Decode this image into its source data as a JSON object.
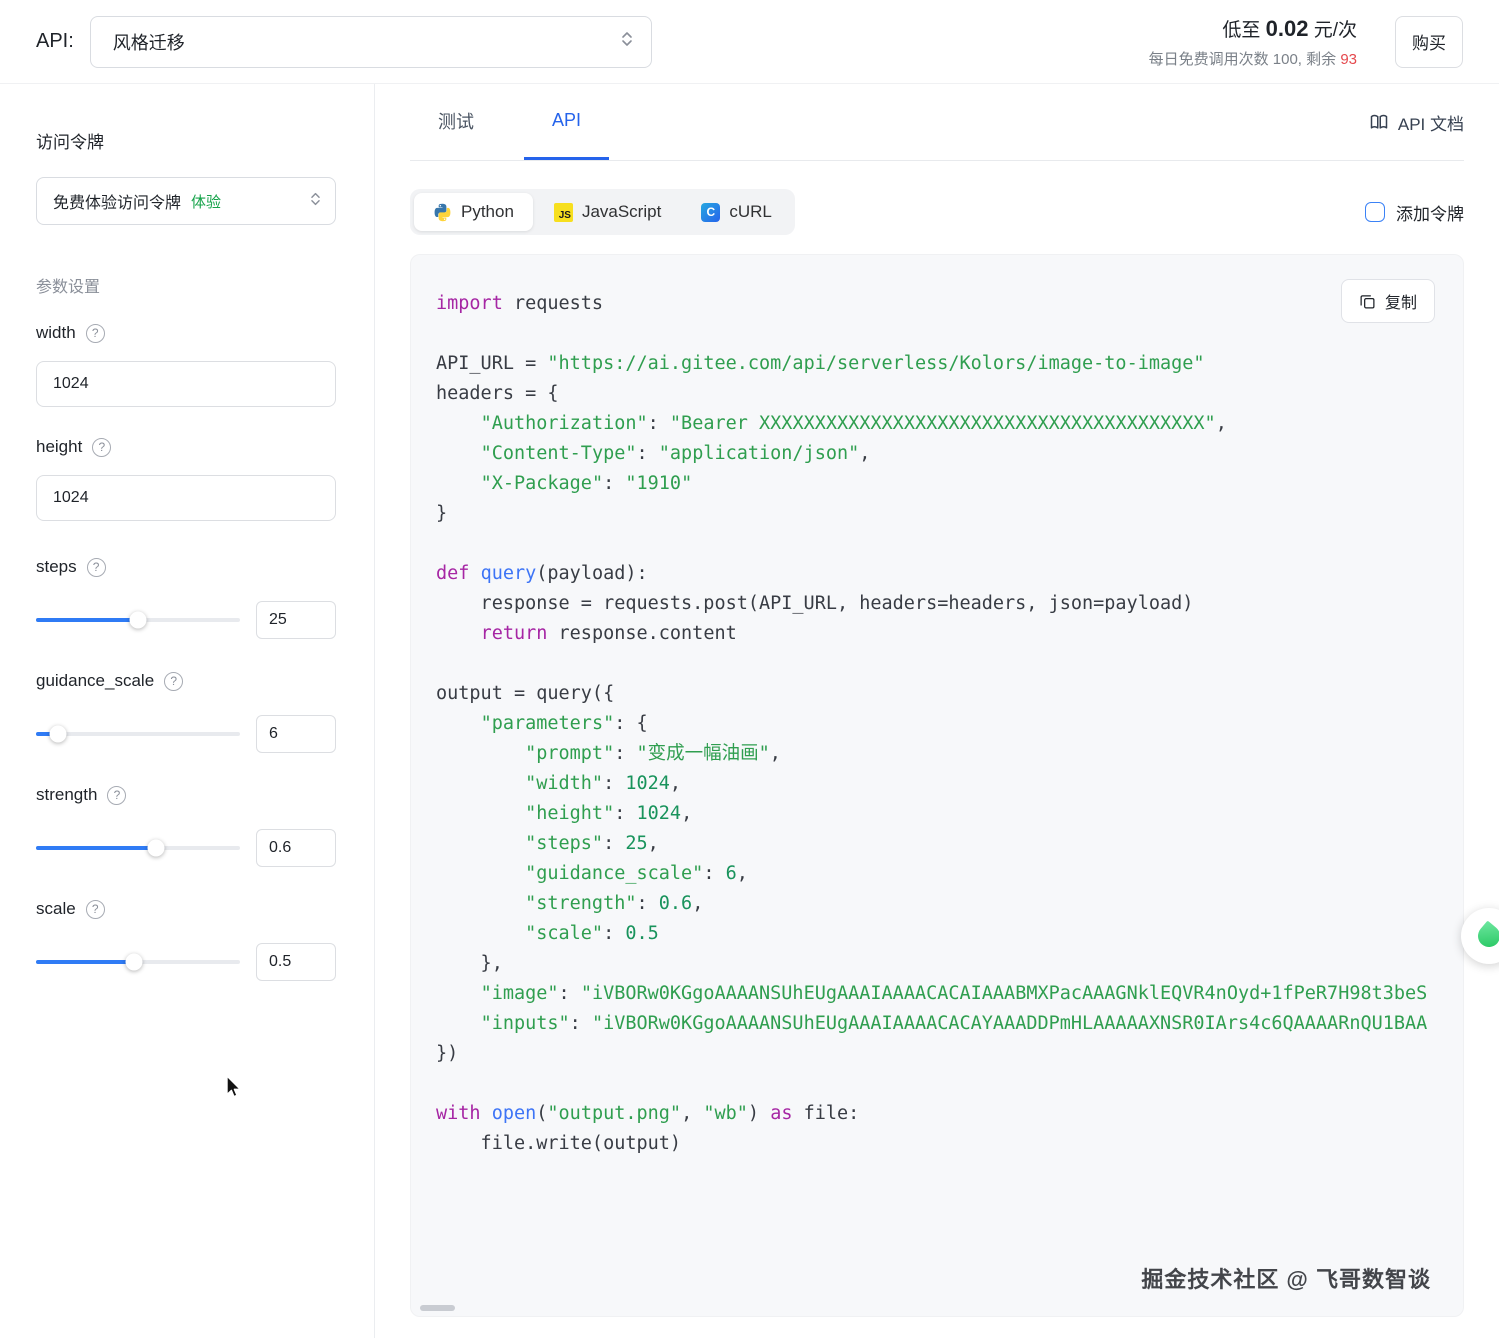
{
  "topbar": {
    "api_label": "API:",
    "model_select": "风格迁移",
    "price_prefix": "低至",
    "price_value": "0.02",
    "price_unit": "元/次",
    "quota_prefix": "每日免费调用次数 100, 剩余",
    "quota_remaining": "93",
    "buy_button": "购买"
  },
  "sidebar": {
    "token_heading": "访问令牌",
    "token_select_value": "免费体验访问令牌",
    "token_badge": "体验",
    "params_heading": "参数设置",
    "params": [
      {
        "name": "width",
        "value": "1024"
      },
      {
        "name": "height",
        "value": "1024"
      },
      {
        "name": "steps",
        "value": "25",
        "percent": 50
      },
      {
        "name": "guidance_scale",
        "value": "6",
        "percent": 11
      },
      {
        "name": "strength",
        "value": "0.6",
        "percent": 59
      },
      {
        "name": "scale",
        "value": "0.5",
        "percent": 48
      }
    ]
  },
  "main": {
    "tabs": [
      {
        "label": "测试"
      },
      {
        "label": "API"
      }
    ],
    "docs_link": "API 文档",
    "lang_tabs": [
      {
        "label": "Python"
      },
      {
        "label": "JavaScript"
      },
      {
        "label": "cURL"
      }
    ],
    "add_token_label": "添加令牌",
    "copy_button": "复制",
    "watermark": "掘金技术社区 @ 飞哥数智谈"
  },
  "colors": {
    "accent_blue": "#2563eb",
    "slider_blue": "#2f7bf5",
    "badge_green": "#16a34a",
    "remaining_red": "#e5484d",
    "code_keyword": "#a626a4",
    "code_function": "#3d74f6",
    "code_string": "#2f9e4f",
    "code_number": "#19935c",
    "python_blue": "#3776ab",
    "python_yellow": "#ffd43b",
    "js_yellow": "#f7df1e"
  },
  "code": {
    "lines": [
      [
        [
          "k",
          "import"
        ],
        [
          "p",
          " requests"
        ]
      ],
      [],
      [
        [
          "p",
          "API_URL = "
        ],
        [
          "s",
          "\"https://ai.gitee.com/api/serverless/Kolors/image-to-image\""
        ]
      ],
      [
        [
          "p",
          "headers = {"
        ]
      ],
      [
        [
          "p",
          "    "
        ],
        [
          "s",
          "\"Authorization\""
        ],
        [
          "p",
          ": "
        ],
        [
          "s",
          "\"Bearer XXXXXXXXXXXXXXXXXXXXXXXXXXXXXXXXXXXXXXXX\""
        ],
        [
          "p",
          ","
        ]
      ],
      [
        [
          "p",
          "    "
        ],
        [
          "s",
          "\"Content-Type\""
        ],
        [
          "p",
          ": "
        ],
        [
          "s",
          "\"application/json\""
        ],
        [
          "p",
          ","
        ]
      ],
      [
        [
          "p",
          "    "
        ],
        [
          "s",
          "\"X-Package\""
        ],
        [
          "p",
          ": "
        ],
        [
          "s",
          "\"1910\""
        ]
      ],
      [
        [
          "p",
          "}"
        ]
      ],
      [],
      [
        [
          "k",
          "def"
        ],
        [
          "p",
          " "
        ],
        [
          "f",
          "query"
        ],
        [
          "p",
          "(payload):"
        ]
      ],
      [
        [
          "p",
          "    response = requests.post(API_URL, headers=headers, json=payload)"
        ]
      ],
      [
        [
          "p",
          "    "
        ],
        [
          "k",
          "return"
        ],
        [
          "p",
          " response.content"
        ]
      ],
      [],
      [
        [
          "p",
          "output = query({"
        ]
      ],
      [
        [
          "p",
          "    "
        ],
        [
          "s",
          "\"parameters\""
        ],
        [
          "p",
          ": {"
        ]
      ],
      [
        [
          "p",
          "        "
        ],
        [
          "s",
          "\"prompt\""
        ],
        [
          "p",
          ": "
        ],
        [
          "s",
          "\"变成一幅油画\""
        ],
        [
          "p",
          ","
        ]
      ],
      [
        [
          "p",
          "        "
        ],
        [
          "s",
          "\"width\""
        ],
        [
          "p",
          ": "
        ],
        [
          "n",
          "1024"
        ],
        [
          "p",
          ","
        ]
      ],
      [
        [
          "p",
          "        "
        ],
        [
          "s",
          "\"height\""
        ],
        [
          "p",
          ": "
        ],
        [
          "n",
          "1024"
        ],
        [
          "p",
          ","
        ]
      ],
      [
        [
          "p",
          "        "
        ],
        [
          "s",
          "\"steps\""
        ],
        [
          "p",
          ": "
        ],
        [
          "n",
          "25"
        ],
        [
          "p",
          ","
        ]
      ],
      [
        [
          "p",
          "        "
        ],
        [
          "s",
          "\"guidance_scale\""
        ],
        [
          "p",
          ": "
        ],
        [
          "n",
          "6"
        ],
        [
          "p",
          ","
        ]
      ],
      [
        [
          "p",
          "        "
        ],
        [
          "s",
          "\"strength\""
        ],
        [
          "p",
          ": "
        ],
        [
          "n",
          "0.6"
        ],
        [
          "p",
          ","
        ]
      ],
      [
        [
          "p",
          "        "
        ],
        [
          "s",
          "\"scale\""
        ],
        [
          "p",
          ": "
        ],
        [
          "n",
          "0.5"
        ]
      ],
      [
        [
          "p",
          "    },"
        ]
      ],
      [
        [
          "p",
          "    "
        ],
        [
          "s",
          "\"image\""
        ],
        [
          "p",
          ": "
        ],
        [
          "s",
          "\"iVBORw0KGgoAAAANSUhEUgAAAIAAAACACAIAAABMXPacAAAGNklEQVR4nOyd+1fPeR7H98t3beS"
        ]
      ],
      [
        [
          "p",
          "    "
        ],
        [
          "s",
          "\"inputs\""
        ],
        [
          "p",
          ": "
        ],
        [
          "s",
          "\"iVBORw0KGgoAAAANSUhEUgAAAIAAAACACAYAAADDPmHLAAAAAXNSR0IArs4c6QAAAARnQU1BAA"
        ]
      ],
      [
        [
          "p",
          "})"
        ]
      ],
      [],
      [
        [
          "k",
          "with"
        ],
        [
          "p",
          " "
        ],
        [
          "f",
          "open"
        ],
        [
          "p",
          "("
        ],
        [
          "s",
          "\"output.png\""
        ],
        [
          "p",
          ", "
        ],
        [
          "s",
          "\"wb\""
        ],
        [
          "p",
          ") "
        ],
        [
          "k",
          "as"
        ],
        [
          "p",
          " file:"
        ]
      ],
      [
        [
          "p",
          "    file.write(output)"
        ]
      ]
    ]
  }
}
